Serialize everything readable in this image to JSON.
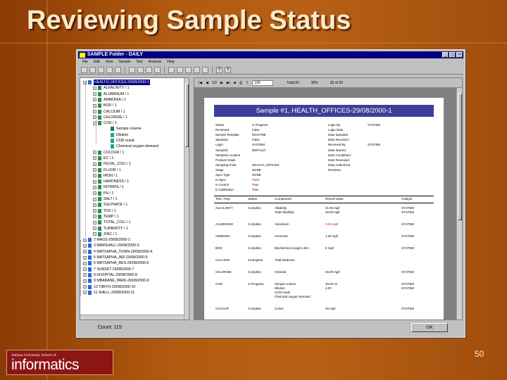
{
  "slide": {
    "title": "Reviewing Sample Status",
    "page_number": "50",
    "logo_small_text": "Indiana University School of",
    "logo_big_text": "informatics"
  },
  "window": {
    "title": "SAMPLE Folder - DAILY",
    "menu": [
      "File",
      "Edit",
      "View",
      "Sample",
      "Test",
      "Analysis",
      "Help"
    ],
    "count_label": "Count: 115",
    "ok_label": "OK"
  },
  "tree": {
    "items": [
      {
        "label": "HEALTH_OFFICES-29/08/2000-1",
        "selected": true,
        "exp": "−"
      },
      {
        "label": "ALKALINITY / 1",
        "exp": "+"
      },
      {
        "label": "ALUMINIUM / 1",
        "exp": "+"
      },
      {
        "label": "AMMONIA / 1",
        "exp": "+"
      },
      {
        "label": "BOD / 1",
        "exp": "+"
      },
      {
        "label": "CALCIUM / 1",
        "exp": "+"
      },
      {
        "label": "CHLORIDE / 1",
        "exp": "+"
      },
      {
        "label": "COD / 1",
        "exp": "−"
      },
      {
        "label": "Sample volume",
        "exp": ""
      },
      {
        "label": "Dilution",
        "exp": ""
      },
      {
        "label": "COD result",
        "exp": ""
      },
      {
        "label": "Chemical oxygen demand",
        "exp": ""
      },
      {
        "label": "COLOUR / 1",
        "exp": "+"
      },
      {
        "label": "EC / 1",
        "exp": "+"
      },
      {
        "label": "FECAL_COLI / 1",
        "exp": "+"
      },
      {
        "label": "FLUOR / 1",
        "exp": "+"
      },
      {
        "label": "IRON / 1",
        "exp": "+"
      },
      {
        "label": "HARDNESS / 1",
        "exp": "+"
      },
      {
        "label": "NITRATE / 1",
        "exp": "+"
      },
      {
        "label": "PH / 1",
        "exp": "+"
      },
      {
        "label": "SALT / 1",
        "exp": "+"
      },
      {
        "label": "SULPHATE / 1",
        "exp": "+"
      },
      {
        "label": "TDS / 1",
        "exp": "+"
      },
      {
        "label": "TEMP / 1",
        "exp": "+"
      },
      {
        "label": "TOTAL_COLI / 1",
        "exp": "+"
      },
      {
        "label": "TURBIDITY / 1",
        "exp": "+"
      },
      {
        "label": "ZINC / 1",
        "exp": "+"
      },
      {
        "label": "2 MAGS-29/08/2000-2",
        "exp": "+"
      },
      {
        "label": "3 MARSHALL-29/08/2000-3",
        "exp": "+"
      },
      {
        "label": "4 MATSAPHA_TOWN-29/08/2000-4",
        "exp": "+"
      },
      {
        "label": "5 MATSAPHA_IND-29/08/2000-5",
        "exp": "+"
      },
      {
        "label": "6 MATSAPHA_RES-29/08/2000-6",
        "exp": "+"
      },
      {
        "label": "7 SUNSET-29/08/2000-7",
        "exp": "+"
      },
      {
        "label": "8 HOSPITAL-29/08/2000-8",
        "exp": "+"
      },
      {
        "label": "9 MBABANE_PARK-29/08/2000-9",
        "exp": "+"
      },
      {
        "label": "10 TIBIYO-29/08/2000-10",
        "exp": "+"
      },
      {
        "label": "11 SHELL-29/08/2000-11",
        "exp": "+"
      }
    ]
  },
  "report_toolbar": {
    "page": "1/2",
    "zoom": "100",
    "total": "Total:30",
    "percent": "30%",
    "range": "30 of 30"
  },
  "report": {
    "header": "Sample #1, HEALTH_OFFICES-29/08/2000-1",
    "left_fields": [
      {
        "label": "Status",
        "value": "In Progress",
        "red": false
      },
      {
        "label": "Reviewed",
        "value": "False",
        "red": false
      },
      {
        "label": "Sample Template",
        "value": "ROUTINE",
        "red": false
      },
      {
        "label": "Standard",
        "value": "False",
        "red": false
      },
      {
        "label": "Login",
        "value": "SYSTEM",
        "red": false
      },
      {
        "label": "Sampled",
        "value": "DEFAULT",
        "red": false
      },
      {
        "label": "Sampled Location",
        "value": "",
        "red": false
      },
      {
        "label": "Product Grade",
        "value": "",
        "red": false
      },
      {
        "label": "Sampling Point",
        "value": "HEALTH_OFFICES",
        "red": false
      },
      {
        "label": "Stage",
        "value": "NONE",
        "red": false
      },
      {
        "label": "Spec Type",
        "value": "NONE",
        "red": false
      },
      {
        "label": "In Spec",
        "value": "False",
        "red": true
      },
      {
        "label": "In Control",
        "value": "True",
        "red": false
      },
      {
        "label": "In Calibration",
        "value": "True",
        "red": false
      }
    ],
    "right_fields": [
      {
        "label": "Login By",
        "value": "SYSTEM"
      },
      {
        "label": "Login Date",
        "value": ""
      },
      {
        "label": "Date Sampled",
        "value": ""
      },
      {
        "label": "Date Received",
        "value": ""
      },
      {
        "label": "Received By",
        "value": "SYSTEM"
      },
      {
        "label": "Date Started",
        "value": ""
      },
      {
        "label": "Date Completed",
        "value": ""
      },
      {
        "label": "Date Reviewed",
        "value": ""
      },
      {
        "label": "Date Authorized",
        "value": ""
      },
      {
        "label": "Reviewer",
        "value": ""
      }
    ],
    "columns": [
      "Test / Rep",
      "Status",
      "Component",
      "Result Value",
      "Analyst"
    ],
    "rows": [
      {
        "test": "ALKALINITY",
        "status": "Complete",
        "components": [
          "Alkalinity",
          "Total Alkalinity"
        ],
        "results": [
          "21.00 mg/l",
          "20.00 mg/l"
        ],
        "red": false,
        "analyst": [
          "SYSTEM",
          "SYSTEM"
        ]
      },
      {
        "test": "ALUMINIUM",
        "status": "Complete",
        "components": [
          "Aluminium"
        ],
        "results": [
          "0.04 mg/l"
        ],
        "red": true,
        "analyst": [
          "SYSTEM"
        ]
      },
      {
        "test": "AMMONIA",
        "status": "Complete",
        "components": [
          "Ammonia"
        ],
        "results": [
          "1.00 mg/l"
        ],
        "red": false,
        "analyst": [
          "SYSTEM"
        ]
      },
      {
        "test": "BOD",
        "status": "Complete",
        "components": [
          "Biochemical oxygen dem"
        ],
        "results": [
          "6 mg/l"
        ],
        "red": false,
        "analyst": [
          "SYSTEM"
        ]
      },
      {
        "test": "CALCIUM",
        "status": "Incomplete",
        "components": [
          "Total hardness"
        ],
        "results": [
          ""
        ],
        "red": false,
        "analyst": [
          ""
        ]
      },
      {
        "test": "CHLORIDE",
        "status": "Complete",
        "components": [
          "Chloride"
        ],
        "results": [
          "20.00 mg/l"
        ],
        "red": false,
        "analyst": [
          "SYSTEM"
        ]
      },
      {
        "test": "COD",
        "status": "In Progress",
        "components": [
          "Sample volume",
          "Dilution",
          "COD result",
          "Chemical oxygen demand"
        ],
        "results": [
          "20.00 ml",
          "4.00",
          "",
          ""
        ],
        "red": false,
        "analyst": [
          "SYSTEM",
          "SYSTEM",
          "",
          ""
        ]
      },
      {
        "test": "COLOUR",
        "status": "Complete",
        "components": [
          "Colour"
        ],
        "results": [
          "20 mg/l"
        ],
        "red": false,
        "analyst": [
          "SYSTEM"
        ]
      }
    ]
  },
  "colors": {
    "accent_header": "#3e3e9a",
    "out_of_spec": "#d00000"
  }
}
